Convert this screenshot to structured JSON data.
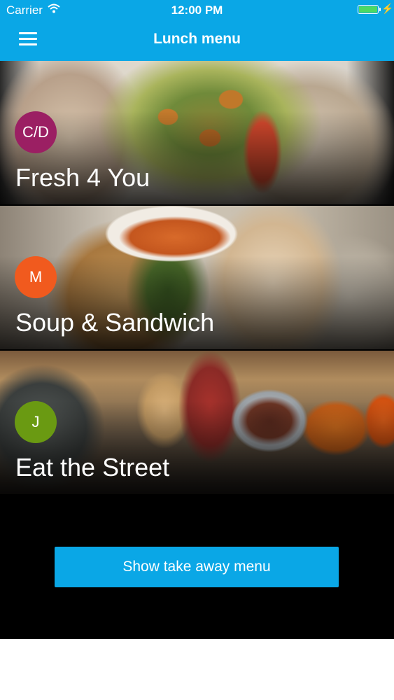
{
  "status_bar": {
    "carrier": "Carrier",
    "time": "12:00 PM"
  },
  "header": {
    "title": "Lunch menu"
  },
  "restaurants": [
    {
      "badge": "C/D",
      "name": "Fresh 4 You",
      "badge_color": "#9b1f63"
    },
    {
      "badge": "M",
      "name": "Soup & Sandwich",
      "badge_color": "#f15a1e"
    },
    {
      "badge": "J",
      "name": "Eat the Street",
      "badge_color": "#6a9a12"
    }
  ],
  "actions": {
    "take_away_label": "Show take away menu"
  },
  "colors": {
    "accent": "#0aa7e6",
    "battery": "#4cd964"
  },
  "icons": {
    "menu": "hamburger-icon",
    "wifi": "wifi-icon",
    "battery": "battery-icon",
    "charging": "bolt-icon"
  }
}
